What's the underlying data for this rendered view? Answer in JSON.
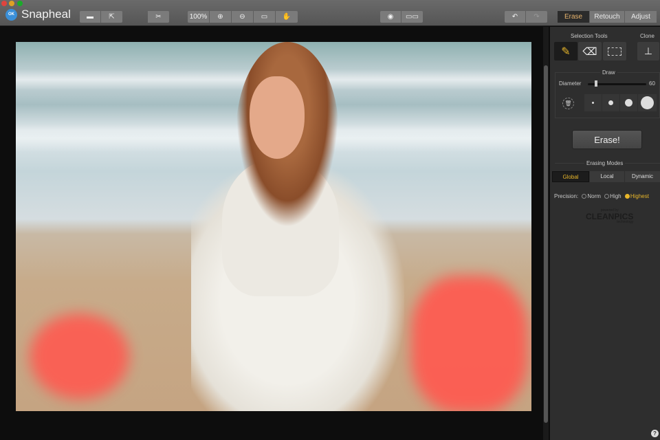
{
  "app": {
    "name": "Snapheal",
    "logo_text": "OK"
  },
  "toolbar": {
    "zoom_level": "100%",
    "modes": [
      "Erase",
      "Retouch",
      "Adjust"
    ],
    "active_mode": "Erase"
  },
  "panel": {
    "selection_tools_label": "Selection Tools",
    "clone_label": "Clone",
    "draw_label": "Draw",
    "diameter_label": "Diameter",
    "diameter_value": "60",
    "diameter_fraction": 0.12,
    "erase_button": "Erase!",
    "erasing_modes_label": "Erasing Modes",
    "modes": [
      "Global",
      "Local",
      "Dynamic"
    ],
    "active_mode": "Global",
    "precision_label": "Precision:",
    "precision_options": [
      "Norm",
      "High",
      "Highest"
    ],
    "precision_selected": "Highest",
    "powered_by": "powered by",
    "brand": "CLEANPICS",
    "brand_sub": "technology",
    "help": "?"
  },
  "colors": {
    "accent": "#e8b46e",
    "selection": "#ff5a50"
  }
}
